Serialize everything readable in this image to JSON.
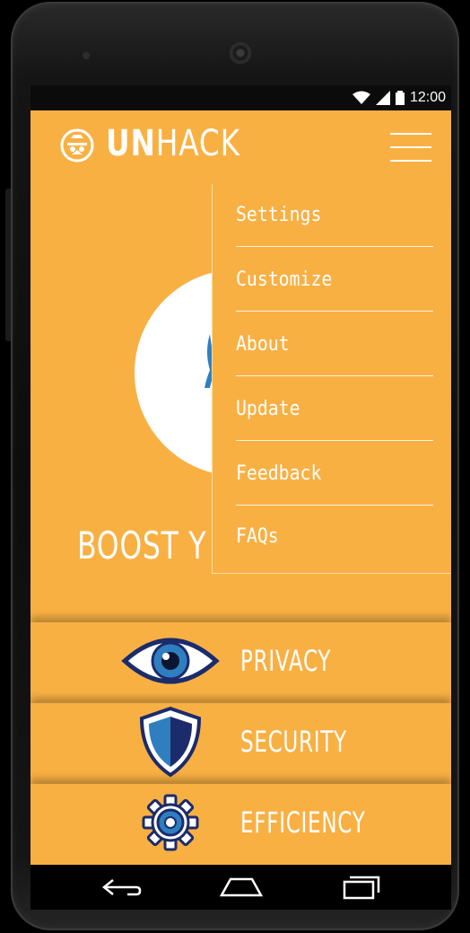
{
  "statusbar": {
    "time": "12:00"
  },
  "appbar": {
    "logo_bold": "UN",
    "logo_light": "HACK"
  },
  "main": {
    "headline": "BOOST Y"
  },
  "menu": {
    "items": [
      {
        "label": "Settings"
      },
      {
        "label": "Customize"
      },
      {
        "label": "About"
      },
      {
        "label": "Update"
      },
      {
        "label": "Feedback"
      },
      {
        "label": "FAQs"
      }
    ]
  },
  "features": [
    {
      "label": "PRIVACY",
      "icon": "eye-icon"
    },
    {
      "label": "SECURITY",
      "icon": "shield-icon"
    },
    {
      "label": "EFFICIENCY",
      "icon": "gear-icon"
    }
  ],
  "colors": {
    "primary": "#F9B043",
    "accent": "#2F7FC0",
    "dark_blue": "#1C2B6B"
  },
  "navbar": {
    "icons": [
      "back-icon",
      "home-icon",
      "recents-icon"
    ]
  }
}
